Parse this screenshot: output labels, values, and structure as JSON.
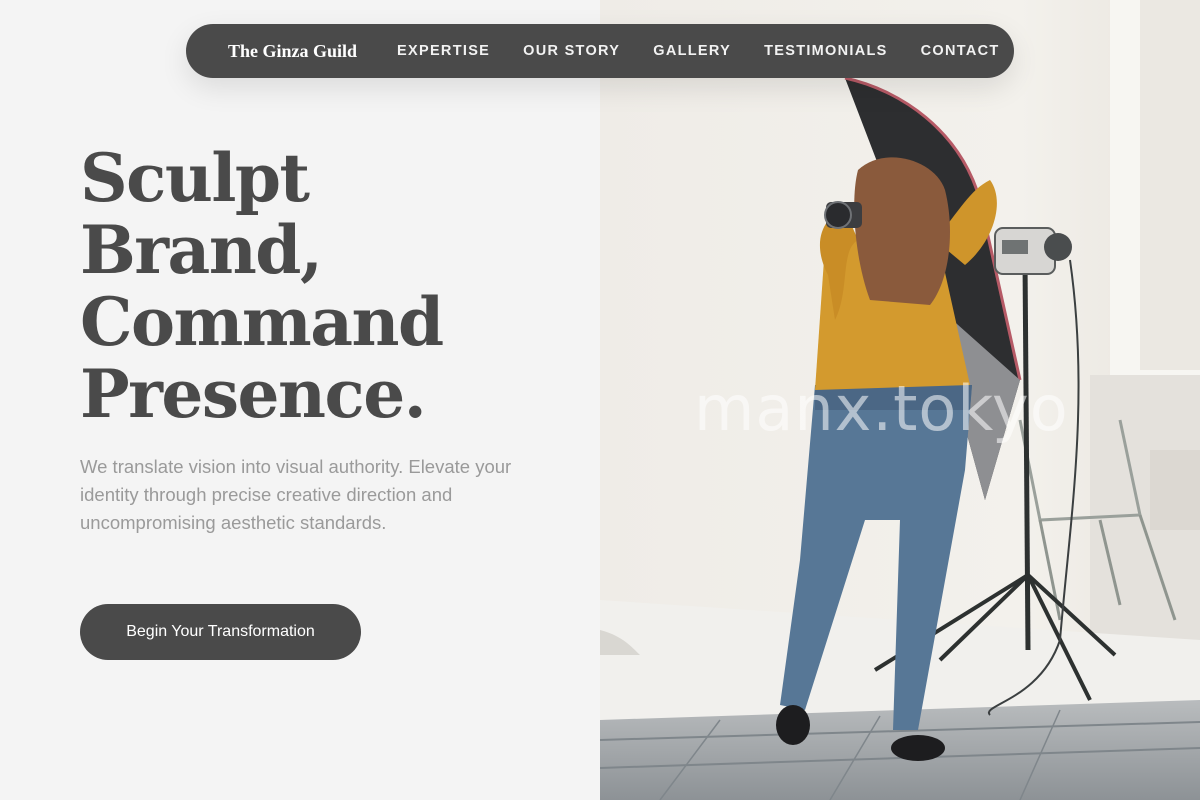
{
  "nav": {
    "brand": "The Ginza Guild",
    "links": [
      "EXPERTISE",
      "OUR STORY",
      "GALLERY",
      "TESTIMONIALS",
      "CONTACT"
    ]
  },
  "hero": {
    "headline_lines": [
      "Sculpt",
      "Brand,",
      "Command",
      "Presence."
    ],
    "subtext": "We translate vision into visual authority. Elevate your identity through precise creative direction and uncompromising aesthetic standards.",
    "cta_label": "Begin Your Transformation"
  },
  "photo": {
    "watermark": "manx.tokyo"
  },
  "colors": {
    "dark": "#4a4a4a",
    "background": "#f4f4f4",
    "muted_text": "#9a9a9a"
  }
}
